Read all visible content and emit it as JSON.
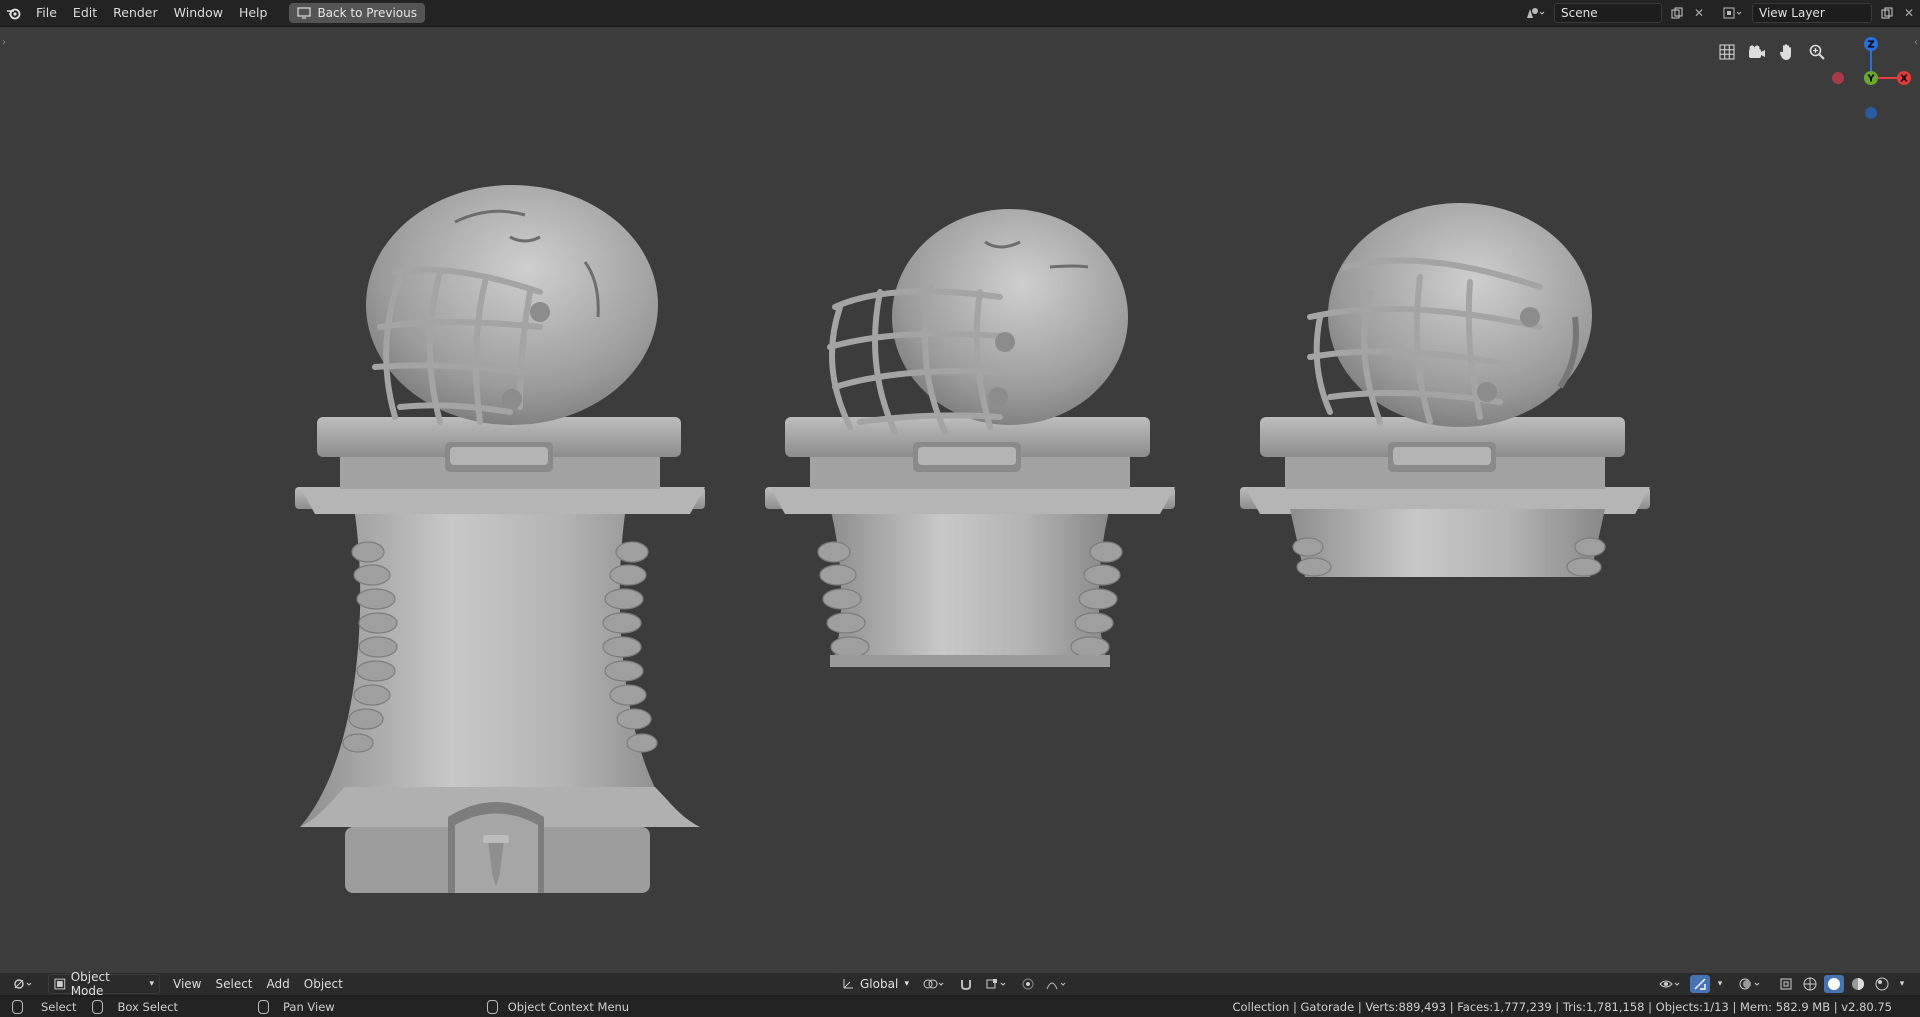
{
  "window": {
    "menu": [
      "File",
      "Edit",
      "Render",
      "Window",
      "Help"
    ],
    "back_label": "Back to Previous",
    "scene": "Scene",
    "view_layer": "View Layer"
  },
  "viewport": {
    "gizmo": {
      "x": "X",
      "y": "Y",
      "z": "Z"
    },
    "colors": {
      "x": "#e23c3c",
      "y": "#6aa82f",
      "z": "#2d6fd8",
      "background": "#3c3c3c",
      "model": "#a9a9a9"
    },
    "nav_icons": [
      "grid-icon",
      "camera-icon",
      "hand-icon",
      "zoom-icon"
    ]
  },
  "header": {
    "mode": "Object Mode",
    "menus": [
      "View",
      "Select",
      "Add",
      "Object"
    ],
    "orientation": "Global"
  },
  "statusbar": {
    "select": "Select",
    "box_select": "Box Select",
    "pan_view": "Pan View",
    "context_menu": "Object Context Menu",
    "stats": "Collection | Gatorade | Verts:889,493 | Faces:1,777,239 | Tris:1,781,158 | Objects:1/13 | Mem: 582.9 MB | v2.80.75"
  }
}
